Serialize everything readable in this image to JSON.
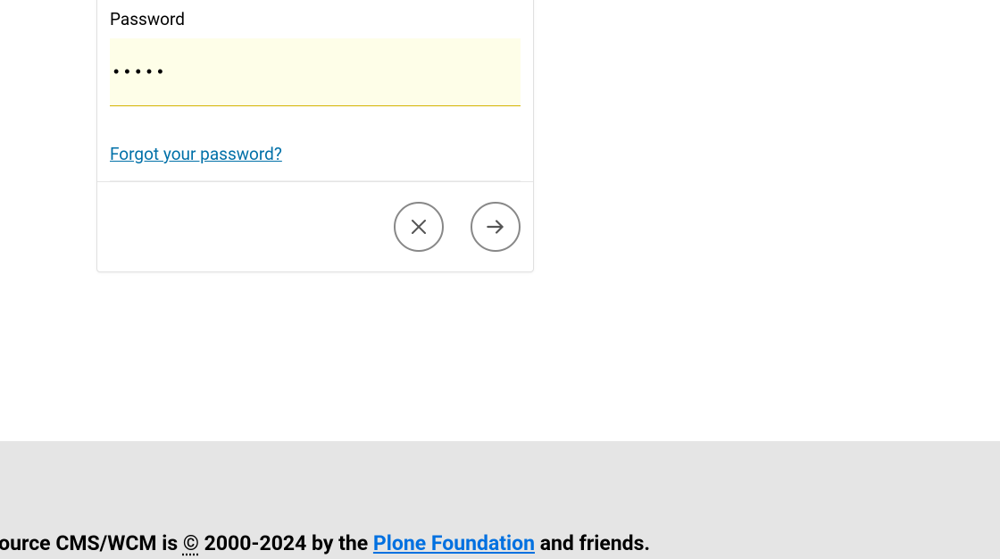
{
  "form": {
    "password_label": "Password",
    "password_value": "•••••",
    "forgot_label": "Forgot your password?"
  },
  "footer": {
    "prefix": "ben Source CMS/WCM is ",
    "copyright_symbol": "©",
    "date_range": " 2000-2024 by the ",
    "link_label": "Plone Foundation",
    "suffix": " and friends."
  }
}
